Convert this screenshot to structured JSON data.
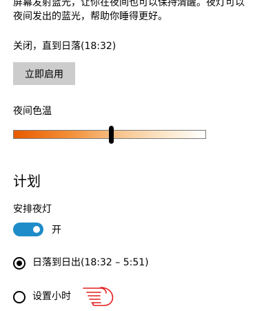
{
  "intro": {
    "line1": "屏幕发射蓝光，让你在夜间也可以保持清醒。夜灯可以",
    "line2": "夜间发出的蓝光，帮助你睡得更好。"
  },
  "status_text": "关闭，直到日落(18:32)",
  "enable_now_button": "立即启用",
  "color_temperature": {
    "label": "夜间色温",
    "level_percent": 51
  },
  "schedule": {
    "title": "计划",
    "schedule_label": "安排夜灯",
    "toggle_state": "开",
    "options": [
      {
        "label": "日落到日出(18:32 – 5:51)",
        "selected": true
      },
      {
        "label": "设置小时",
        "selected": false
      }
    ]
  },
  "colors": {
    "toggle_on": "#1e8cc8",
    "button_bg": "#cccccc",
    "pointer_annotation": "#e31b1b"
  },
  "icons": {
    "annotation": "pointing-hand-icon"
  }
}
